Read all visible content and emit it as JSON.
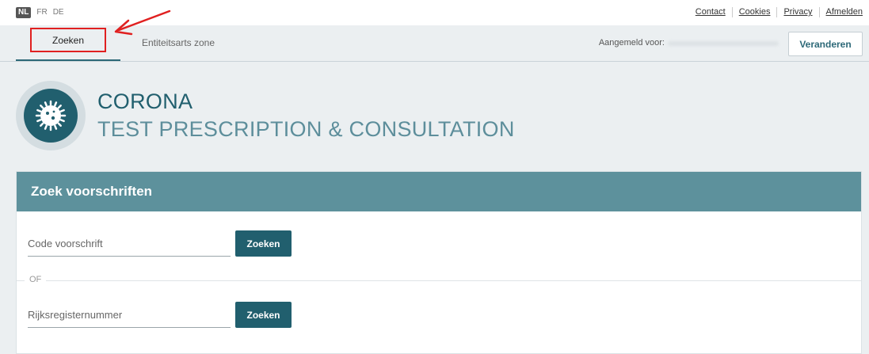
{
  "top": {
    "languages": [
      {
        "code": "NL",
        "active": true
      },
      {
        "code": "FR",
        "active": false
      },
      {
        "code": "DE",
        "active": false
      }
    ],
    "links": [
      "Contact",
      "Cookies",
      "Privacy",
      "Afmelden"
    ]
  },
  "nav": {
    "tabs": [
      {
        "label": "Zoeken",
        "active": true
      },
      {
        "label": "Entiteitsarts zone",
        "active": false
      }
    ],
    "logged_in_label": "Aangemeld voor:",
    "change_label": "Veranderen"
  },
  "brand": {
    "title": "CORONA",
    "subtitle": "TEST PRESCRIPTION & CONSULTATION",
    "logo_icon": "virus-icon"
  },
  "search": {
    "header": "Zoek voorschriften",
    "code_placeholder": "Code voorschrift",
    "code_value": "",
    "or_label": "OF",
    "rijks_placeholder": "Rijksregisternummer",
    "rijks_value": "",
    "button_label": "Zoeken"
  },
  "colors": {
    "accent": "#215f6e",
    "header_bg": "#5d919c",
    "page_bg": "#ebeff1",
    "annotation": "#e02020"
  }
}
